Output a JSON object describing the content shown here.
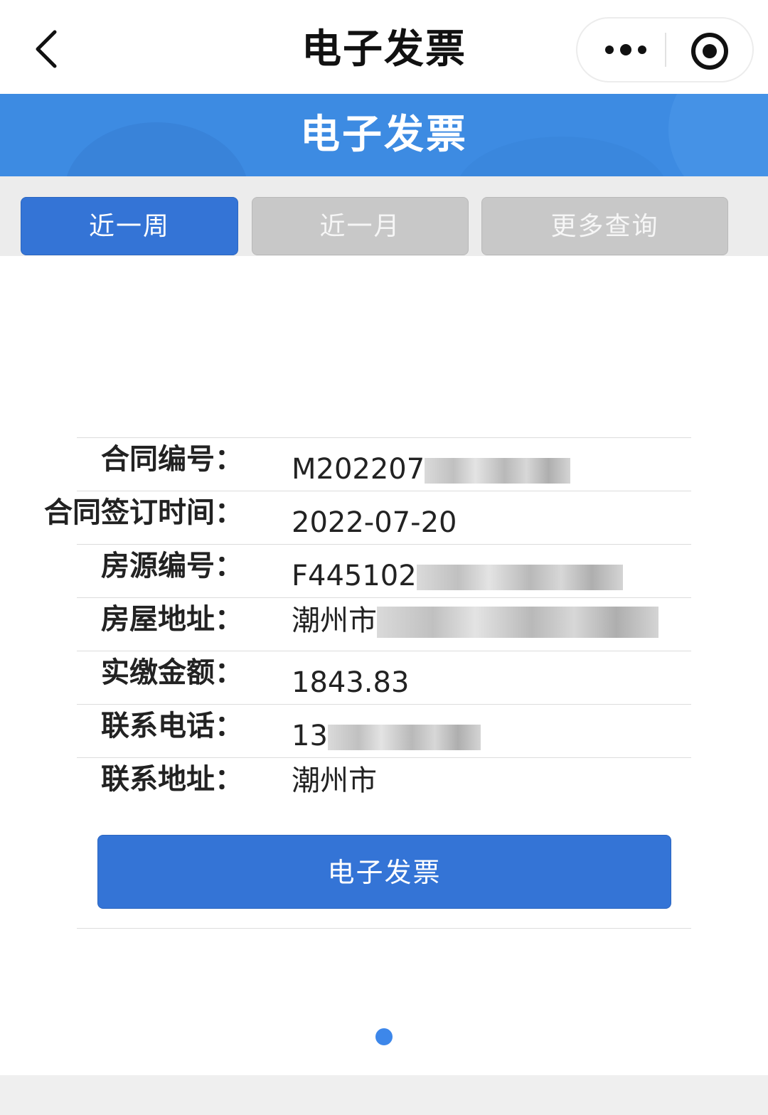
{
  "navbar": {
    "title": "电子发票",
    "back_icon": "chevron-left-icon",
    "more_icon": "more-dots-icon",
    "close_icon": "target-close-icon"
  },
  "banner": {
    "title": "电子发票",
    "color": "#3d8be2"
  },
  "tabs": [
    {
      "label": "近一周",
      "active": true
    },
    {
      "label": "近一月",
      "active": false
    },
    {
      "label": "更多查询",
      "active": false
    }
  ],
  "info": {
    "contract_no": {
      "label": "合同编号：",
      "value": "M202207"
    },
    "sign_date": {
      "label": "合同签订时间：",
      "value": "2022-07-20"
    },
    "house_no": {
      "label": "房源编号：",
      "value": "F445102"
    },
    "house_address": {
      "label": "房屋地址：",
      "value": "潮州市"
    },
    "paid_amount": {
      "label": "实缴金额：",
      "value": "1843.83"
    },
    "phone": {
      "label": "联系电话：",
      "value": "13"
    },
    "contact_address": {
      "label": "联系地址：",
      "value": "潮州市"
    }
  },
  "actions": {
    "invoice_button": "电子发票"
  },
  "colors": {
    "primary": "#3474d6",
    "inactive_tab": "#c8c8c8"
  }
}
